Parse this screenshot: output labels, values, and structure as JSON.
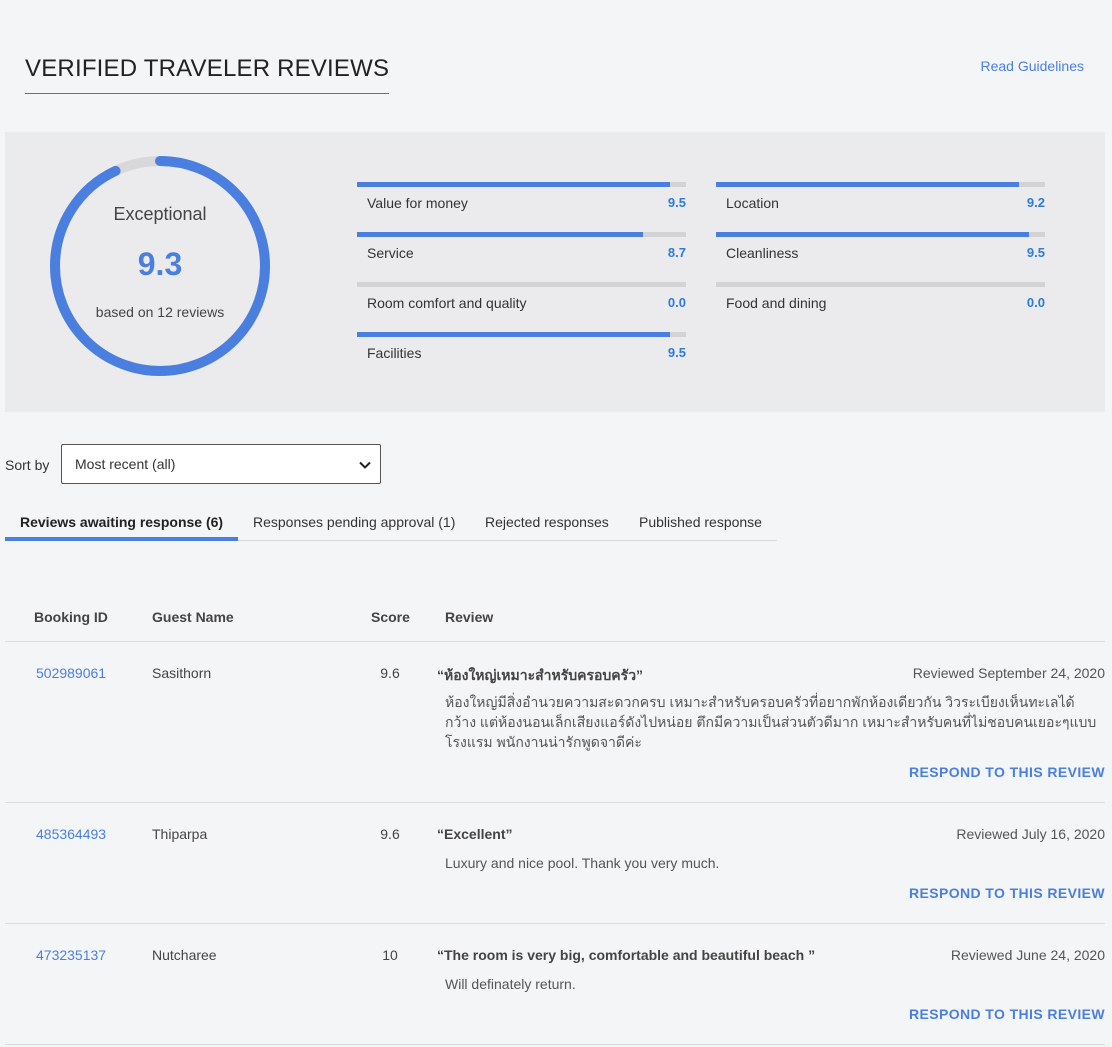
{
  "header": {
    "title": "VERIFIED TRAVELER REVIEWS",
    "guidelines_link": "Read Guidelines"
  },
  "summary": {
    "rating_label": "Exceptional",
    "overall_score": "9.3",
    "overall_score_fraction": 0.93,
    "review_count_text": "based on 12 reviews",
    "categories": [
      {
        "name": "Value for money",
        "score": "9.5",
        "fill": 0.95
      },
      {
        "name": "Location",
        "score": "9.2",
        "fill": 0.92
      },
      {
        "name": "Service",
        "score": "8.7",
        "fill": 0.87
      },
      {
        "name": "Cleanliness",
        "score": "9.5",
        "fill": 0.95
      },
      {
        "name": "Room comfort and quality",
        "score": "0.0",
        "fill": 0.0
      },
      {
        "name": "Food and dining",
        "score": "0.0",
        "fill": 0.0
      },
      {
        "name": "Facilities",
        "score": "9.5",
        "fill": 0.95
      }
    ]
  },
  "sort": {
    "label": "Sort by",
    "selected": "Most recent (all)"
  },
  "tabs": [
    {
      "label": "Reviews awaiting response (6)",
      "active": true
    },
    {
      "label": "Responses pending approval (1)",
      "active": false
    },
    {
      "label": "Rejected responses",
      "active": false
    },
    {
      "label": "Published response",
      "active": false
    }
  ],
  "table": {
    "headers": {
      "booking_id": "Booking ID",
      "guest_name": "Guest Name",
      "score": "Score",
      "review": "Review"
    },
    "rows": [
      {
        "booking_id": "502989061",
        "guest": "Sasithorn",
        "score": "9.6",
        "title": "“ห้องใหญ่เหมาะสำหรับครอบครัว”",
        "date": "Reviewed September 24, 2020",
        "body": "ห้องใหญ่มีสิ่งอำนวยความสะดวกครบ เหมาะสำหรับครอบครัวที่อยากพักห้องเดียวกัน วิวระเบียงเห็นทะเลได้กว้าง แต่ห้องนอนเล็กเสียงแอร์ดังไปหน่อย ตึกมีความเป็นส่วนตัวดีมาก เหมาะสำหรับคนที่ไม่ชอบคนเยอะๆแบบโรงแรม พนักงานน่ารักพูดจาดีค่ะ",
        "respond": "RESPOND TO THIS REVIEW"
      },
      {
        "booking_id": "485364493",
        "guest": "Thiparpa",
        "score": "9.6",
        "title": "“Excellent”",
        "date": "Reviewed July 16, 2020",
        "body": "Luxury and nice pool. Thank you very much.",
        "respond": "RESPOND TO THIS REVIEW"
      },
      {
        "booking_id": "473235137",
        "guest": "Nutcharee",
        "score": "10",
        "title": "“The room is very big, comfortable and beautiful beach ”",
        "date": "Reviewed June 24, 2020",
        "body": "Will definately return.",
        "respond": "RESPOND TO THIS REVIEW"
      }
    ]
  },
  "colors": {
    "accent": "#4a7fe0",
    "title_underline": "#e0443b",
    "ring_track": "#d8d8db"
  },
  "icons": {
    "select": "chevron-down-icon"
  }
}
